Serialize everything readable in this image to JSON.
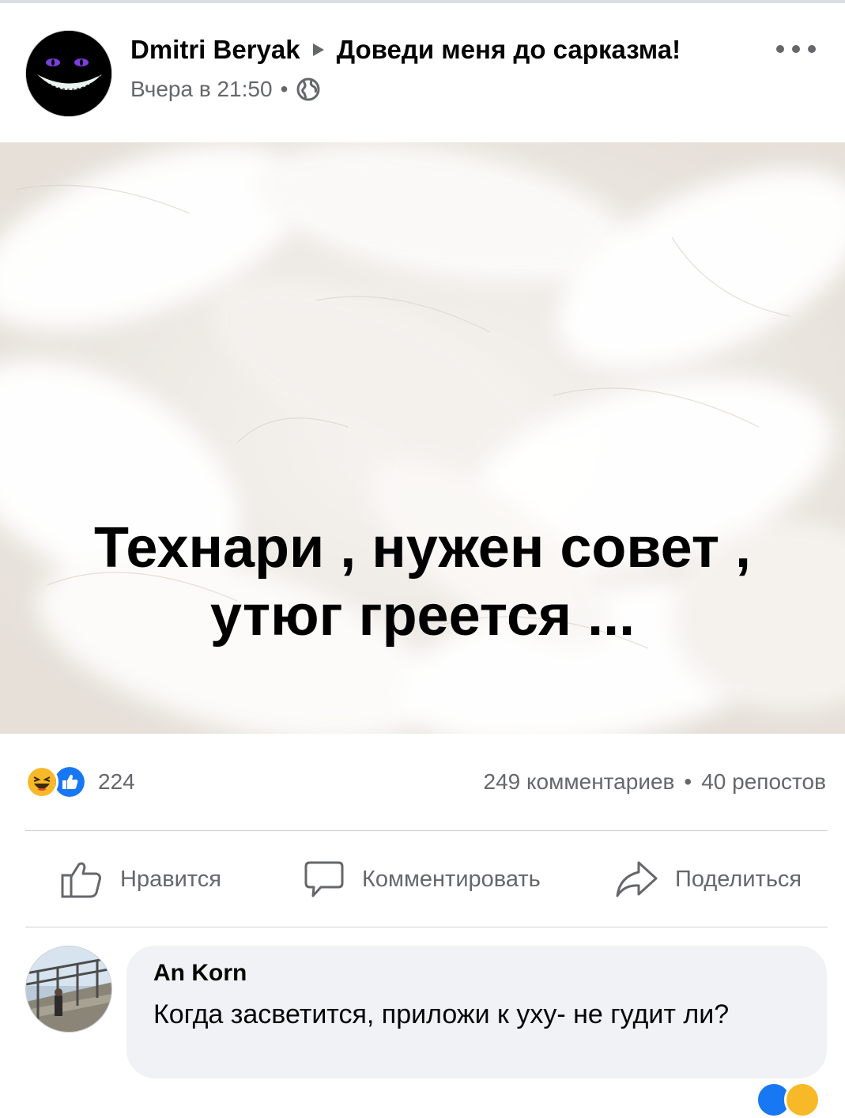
{
  "post": {
    "author": "Dmitri Beryak",
    "group": "Доведи меня до сарказма!",
    "time": "Вчера в 21:50",
    "separator": "•",
    "image_text_line1": "Технари , нужен совет ,",
    "image_text_line2": "утюг греется ..."
  },
  "stats": {
    "reaction_count": "224",
    "comments": "249 комментариев",
    "shares": "40 репостов",
    "separator": "•"
  },
  "actions": {
    "like": "Нравится",
    "comment": "Комментировать",
    "share": "Поделиться"
  },
  "comment": {
    "author": "An Korn",
    "text": "Когда засветится, приложи к уху- не гудит ли?"
  },
  "colors": {
    "secondary_text": "#65676b",
    "like_blue": "#1877f2",
    "haha_yellow": "#f7b928",
    "bubble_bg": "#f0f2f5",
    "divider": "#ced0d4"
  }
}
